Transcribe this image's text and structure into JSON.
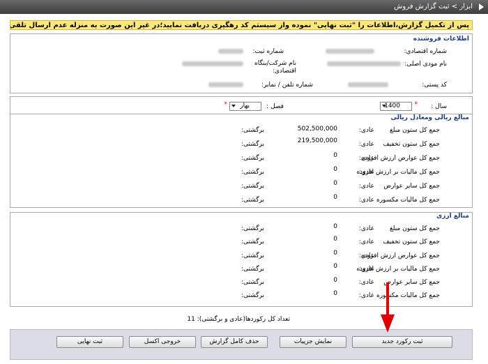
{
  "breadcrumb": "ابزار > ثبت گزارش فروش",
  "warning": "پس از تکمیل گزارش،اطلاعات را \"ثبت نهایی\" نموده واز سیستم کد رهگیری دریافت نمایید؛در غیر این صورت به منزله عدم ارسال تلقی می گردد!",
  "seller": {
    "legend": "اطلاعات فروشنده",
    "economic_code_label": "شماره اقتصادی:",
    "reg_no_label": "شماره ثبت:",
    "taxpayer_name_label": "نام مودی اصلی:",
    "company_name_label": "نام شرکت/بنگاه اقتصادی:",
    "postal_code_label": "کد پستی:",
    "phone_label": "شماره تلفن / نمابر:"
  },
  "filters": {
    "year_label": "سال :",
    "year_value": "1400",
    "season_label": "فصل :",
    "season_value": "بهار",
    "required_mark": "*"
  },
  "rial": {
    "legend": "مبالغ ریالی ومعادل ریالی",
    "normal_label": "عادی:",
    "return_label": "برگشتی:",
    "rows": [
      {
        "label": "جمع کل ستون مبلغ",
        "normal": "502,500,000"
      },
      {
        "label": "جمع کل ستون تخفیف",
        "normal": "219,500,000"
      },
      {
        "label": "جمع کل عوارض ارزش افزوده",
        "normal": "0"
      },
      {
        "label": "جمع کل مالیات بر ارزش افزوده",
        "normal": "0"
      },
      {
        "label": "جمع کل سایر عوارض",
        "normal": "0"
      },
      {
        "label": "جمع کل مالیات مکسوره",
        "normal": "0"
      }
    ]
  },
  "fx": {
    "legend": "مبالغ ارزی",
    "normal_label": "عادی:",
    "return_label": "برگشتی:",
    "rows": [
      {
        "label": "جمع کل ستون مبلغ",
        "normal": "0"
      },
      {
        "label": "جمع کل ستون تخفیف",
        "normal": "0"
      },
      {
        "label": "جمع کل عوارض ارزش افزوده",
        "normal": "0"
      },
      {
        "label": "جمع کل مالیات بر ارزش افزوده",
        "normal": "0"
      },
      {
        "label": "جمع کل سایر عوارض",
        "normal": "0"
      },
      {
        "label": "جمع کل مالیات مکسوره",
        "normal": "0"
      }
    ]
  },
  "record_count": "تعداد کل رکوردها(عادی و برگشتی): 11",
  "buttons": {
    "new_record": "ثبت رکورد جدید",
    "show_details": "نمایش جزییات",
    "delete_report": "حذف کامل گزارش",
    "export_excel": "خروجی اکسل",
    "finalize": "ثبت نهایی"
  },
  "colors": {
    "legend": "#1a3a8c",
    "warning_bg": "#ffe87a",
    "annotation_arrow": "#e00000"
  }
}
